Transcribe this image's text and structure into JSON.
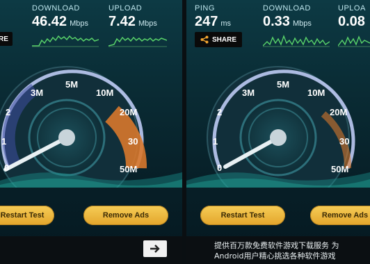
{
  "left": {
    "download": {
      "label": "DOWNLOAD",
      "value": "46.42",
      "unit": "Mbps"
    },
    "upload": {
      "label": "UPLOAD",
      "value": "7.42",
      "unit": "Mbps"
    },
    "share_partial": "RE",
    "gauge_ticks": [
      "0",
      "1",
      "2",
      "3M",
      "5M",
      "10M",
      "20M",
      "30",
      "50M"
    ],
    "start_button": "Restart Test",
    "remove_ads_button": "Remove Ads"
  },
  "right": {
    "ping": {
      "label": "PING",
      "value": "247",
      "unit": "ms"
    },
    "download": {
      "label": "DOWNLOAD",
      "value": "0.33",
      "unit": "Mbps"
    },
    "upload": {
      "label": "UPLOA",
      "value": "0.08"
    },
    "share_label": "SHARE",
    "gauge_ticks": [
      "0",
      "1",
      "2",
      "3M",
      "5M",
      "10M",
      "20M",
      "30",
      "50M"
    ],
    "start_button": "Restart Test",
    "remove_ads_button": "Remove Ads",
    "ad_line1": "提供百万款免费软件游戏下载服务 为",
    "ad_line2": "Android用户精心挑选各种软件游戏"
  },
  "colors": {
    "accent": "#f2c14e",
    "needle": "#dfe9ee",
    "ring": "#c8d4ff",
    "gauge_hot": "#d8782c"
  },
  "icons": {
    "share": "share-icon",
    "arrow": "arrow-right-icon"
  }
}
